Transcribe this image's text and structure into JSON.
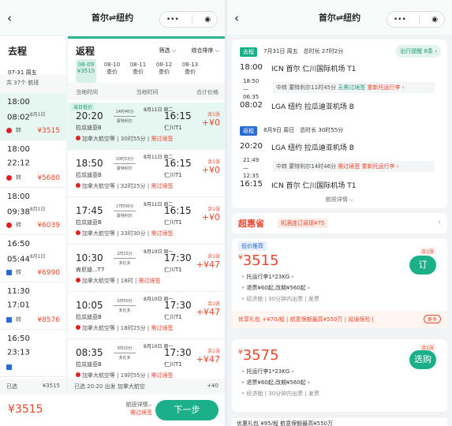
{
  "app": {
    "title": "首尔⇌纽约",
    "capsule_more": "•••",
    "capsule_close": "◉"
  },
  "left": {
    "outbound": {
      "label": "去程",
      "date": "07-31 周五"
    },
    "flight_count": "共 37个 航班",
    "rows": [
      {
        "dep": "18:00",
        "arr": "08:02",
        "arr_sup": "8月1日",
        "price": "¥3515",
        "airline": "转",
        "alicon": "red"
      },
      {
        "dep": "18:00",
        "arr": "22:12",
        "arr_sup": "",
        "price": "¥5680",
        "airline": "转",
        "alicon": "red"
      },
      {
        "dep": "18:00",
        "arr": "09:38",
        "arr_sup": "8月1日",
        "price": "¥6039",
        "airline": "转",
        "alicon": "red"
      },
      {
        "dep": "16:50",
        "arr": "05:44",
        "arr_sup": "8月1日",
        "price": "¥6990",
        "airline": "转",
        "alicon": "blue"
      },
      {
        "dep": "11:30",
        "arr": "17:01",
        "arr_sup": "",
        "price": "¥8576",
        "airline": "转",
        "alicon": "blue"
      },
      {
        "dep": "16:50",
        "arr": "23:13",
        "arr_sup": "",
        "price": "",
        "airline": "",
        "alicon": "blue"
      }
    ],
    "return": {
      "label": "返程",
      "filter": "筛选 ⌵",
      "sort": "综合排序 ⌵"
    },
    "dates": [
      {
        "d": "08-09",
        "p": "¥3515"
      },
      {
        "d": "08-10",
        "p": "查价"
      },
      {
        "d": "08-11",
        "p": "查价"
      },
      {
        "d": "08-12",
        "p": "查价"
      },
      {
        "d": "08-13",
        "p": "查价"
      }
    ],
    "col_headers": {
      "dep": "当地时间",
      "arr": "当地时间",
      "total": "合计价格"
    },
    "ret_rows": [
      {
        "tag": "当日低价",
        "dep": "20:20",
        "arr": "16:15",
        "date": "8月11日 周二",
        "dur": "14时46分",
        "via": "蒙特利尔",
        "ap1": "拉瓜迪亚B",
        "ap2": "仁川T1",
        "pr_top": "余1张",
        "price": "+¥0",
        "info": "加拿大航空等 | 30时55分 |",
        "warn": "需过境签"
      },
      {
        "tag": "",
        "dep": "18:50",
        "arr": "16:15",
        "date": "8月11日 周二",
        "dur": "10时53分",
        "via": "蒙特利尔",
        "ap1": "拉瓜迪亚B",
        "ap2": "仁川T1",
        "pr_top": "余1张",
        "price": "+¥0",
        "info": "加拿大航空等 | 32时25分 |",
        "warn": "需过境签"
      },
      {
        "tag": "",
        "dep": "17:45",
        "arr": "16:15",
        "date": "8月11日 周二",
        "dur": "17时56分",
        "via": "蒙特利尔",
        "ap1": "拉瓜迪亚B",
        "ap2": "仁川T1",
        "pr_top": "余1张",
        "price": "+¥0",
        "info": "加拿大航空等 | 33时30分 |",
        "warn": "需过境签"
      },
      {
        "tag": "",
        "dep": "10:30",
        "arr": "17:30",
        "date": "8月10日 周一",
        "dur": "1时25分",
        "via": "多伦多",
        "ap1": "肯尼迪...T7",
        "ap2": "仁川T1",
        "pr_top": "余1张",
        "price": "+¥47",
        "info": "加拿大航空等 | 18时 |",
        "warn": "需过境签"
      },
      {
        "tag": "",
        "dep": "10:05",
        "arr": "17:30",
        "date": "8月10日 周一",
        "dur": "1时50分",
        "via": "多伦多",
        "ap1": "拉瓜迪亚B",
        "ap2": "仁川T1",
        "pr_top": "余1张",
        "price": "+¥47",
        "info": "加拿大航空等 | 18时25分 |",
        "warn": "需过境签"
      },
      {
        "tag": "",
        "dep": "08:35",
        "arr": "17:30",
        "date": "8月10日 周一",
        "dur": "3时20分",
        "via": "多伦多",
        "ap1": "拉瓜迪亚B",
        "ap2": "仁川T1",
        "pr_top": "余1张",
        "price": "+¥47",
        "info": "加拿大航空等 | 19时55分 |",
        "warn": "需过境签"
      }
    ],
    "status_left": {
      "label": "已选",
      "price": "¥3515"
    },
    "status_right": {
      "text": "已选 20:20 出发 加拿大航空",
      "price": "+¥0"
    },
    "bottom": {
      "total": "¥3515",
      "details": "航班详情⌵",
      "warn": "需过境签",
      "next": "下一步"
    }
  },
  "right": {
    "outbound": {
      "label": "去程",
      "date": "7月31日 周五",
      "total": "总时长 27时2分",
      "remind": "出行提醒 8条 ›",
      "dep_time": "18:00",
      "dep_ap": "ICN 首尔 仁川国际机场 T1",
      "stop_times": "18:50\n—\n06:35",
      "stop": "中转 蒙特利尔11时45分",
      "stop_g": "无需过境签",
      "stop_o": "重新托运行李 ›",
      "arr_time": "08:02",
      "arr_ap": "LGA 纽约 拉瓜迪亚机场 B"
    },
    "return": {
      "label": "返程",
      "date": "8月9日 周日",
      "total": "总时长 30时55分",
      "dep_time": "20:20",
      "dep_ap": "LGA 纽约 拉瓜迪亚机场 B",
      "stop_times": "21:49\n—\n12:35",
      "stop": "中转 蒙特利尔14时46分",
      "stop_o": "需过境签",
      "stop_o2": "重新托运行李 ›",
      "arr_time": "16:15",
      "arr_ap": "ICN 首尔 仁川国际机场 T1"
    },
    "flight_details": "航班详情 ⌵",
    "promo": {
      "logo": "超惠省",
      "text": "机酒连订返现¥75",
      "chev": "›"
    },
    "offer1": {
      "label": "低价推荐",
      "price": "3515",
      "lines": [
        "托运行李1*23KG ›",
        "退票¥60起,改期¥560起 ›",
        "经济舱 | 30分钟内出票 | 发票"
      ],
      "btn": "订",
      "badge": "余1张"
    },
    "gift": {
      "text": "优享礼包 +¥70/程 | 航意保额最高¥550万 | 延误保险 |",
      "more": "更多"
    },
    "offer2": {
      "price": "3575",
      "lines": [
        "托运行李1*23KG ›",
        "退票¥60起,改期¥560起 ›",
        "经济舱 | 30分钟内出票 | 发票"
      ],
      "btn": "选购",
      "badge": "余1张"
    },
    "foot": "优惠礼包 ¥95/程 航意保额最高¥550万"
  }
}
